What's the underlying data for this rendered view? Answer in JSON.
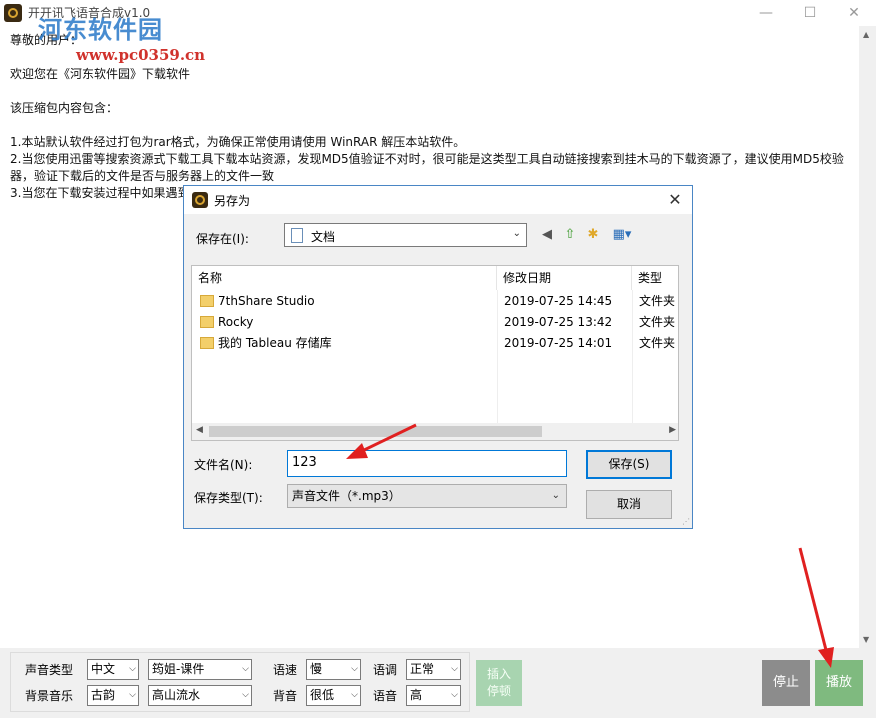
{
  "window": {
    "title": "开开讯飞语音合成v1.0",
    "watermark_text": "河东软件园",
    "watermark_url": "www.pc0359.cn"
  },
  "notice": {
    "lines": [
      "尊敬的用户：",
      "欢迎您在《河东软件园》下载软件",
      "",
      "该压缩包内容包含：",
      "",
      "1.本站默认软件经过打包为rar格式，为确保正常使用请使用 WinRAR 解压本站软件。",
      "2.当您使用迅雷等搜索资源式下载工具下载本站资源，发现MD5值验证不对时，很可能是这类型工具自动链接搜索到挂木马的下载资源了，建议使用MD5校验",
      "器，验证下载后的文件是否与服务器上的文件一致",
      "3.当您在下载安装过程中如果遇到"
    ]
  },
  "save_dialog": {
    "title": "另存为",
    "save_in_label": "保存在(I):",
    "location": "文档",
    "columns": {
      "name": "名称",
      "date": "修改日期",
      "type": "类型"
    },
    "files": [
      {
        "name": "7thShare Studio",
        "date": "2019-07-25 14:45",
        "type": "文件夹"
      },
      {
        "name": "Rocky",
        "date": "2019-07-25 13:42",
        "type": "文件夹"
      },
      {
        "name": "我的 Tableau 存储库",
        "date": "2019-07-25 14:01",
        "type": "文件夹"
      }
    ],
    "filename_label": "文件名(N):",
    "filename_value": "123",
    "filetype_label": "保存类型(T):",
    "filetype_value": "声音文件（*.mp3）",
    "save_button": "保存(S)",
    "cancel_button": "取消"
  },
  "controls": {
    "voice_type_label": "声音类型",
    "language": "中文",
    "voice": "筠姐-课件",
    "speed_label": "语速",
    "speed": "慢",
    "tone_label": "语调",
    "tone": "正常",
    "bg_music_label": "背景音乐",
    "music_style": "古韵",
    "music_track": "高山流水",
    "background_label": "背音",
    "background_volume": "很低",
    "volume_label": "语音",
    "volume": "高",
    "insert_pause_line1": "插入",
    "insert_pause_line2": "停顿",
    "stop_button": "停止",
    "play_button": "播放"
  },
  "colors": {
    "annotation_arrow": "#e02020",
    "play_button": "#7fba7f",
    "stop_button": "#8c8c8c",
    "insert_button": "#a8d4b0",
    "dialog_border": "#4a86c5"
  }
}
